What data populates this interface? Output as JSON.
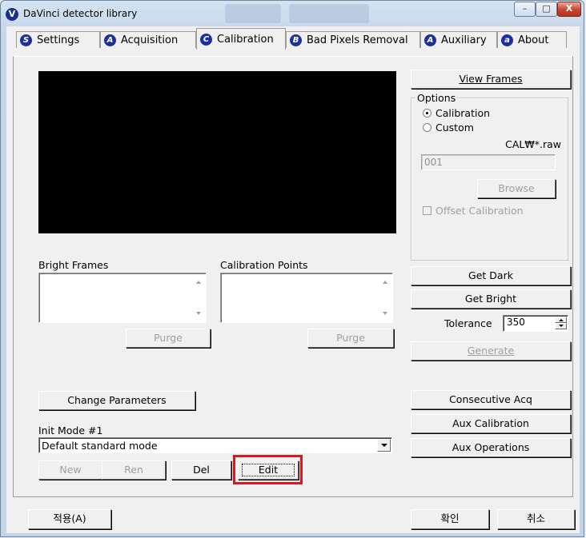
{
  "window": {
    "title": "DaVinci detector library",
    "minimize": "–",
    "maximize": "□",
    "close": "X"
  },
  "tabs": [
    {
      "label": "Settings",
      "icon": "S"
    },
    {
      "label": "Acquisition",
      "icon": "A"
    },
    {
      "label": "Calibration",
      "icon": "C",
      "active": true
    },
    {
      "label": "Bad Pixels Removal",
      "icon": "B"
    },
    {
      "label": "Auxiliary",
      "icon": "A"
    },
    {
      "label": "About",
      "icon": "a"
    }
  ],
  "left": {
    "bright_frames_label": "Bright Frames",
    "calibration_points_label": "Calibration Points",
    "purge_label": "Purge",
    "change_parameters": "Change Parameters",
    "init_mode_label": "Init Mode #1",
    "init_mode_value": "Default standard mode",
    "new": "New",
    "ren": "Ren",
    "del": "Del",
    "edit": "Edit"
  },
  "right": {
    "view_frames": "View Frames",
    "options_title": "Options",
    "radio_calibration": "Calibration",
    "radio_custom": "Custom",
    "file_pattern": "CAL₩*.raw",
    "file_index": "001",
    "browse": "Browse",
    "offset_calibration": "Offset Calibration",
    "get_dark": "Get Dark",
    "get_bright": "Get Bright",
    "tolerance_label": "Tolerance",
    "tolerance_value": "350",
    "generate": "Generate",
    "consecutive_acq": "Consecutive Acq",
    "aux_calibration": "Aux Calibration",
    "aux_operations": "Aux Operations"
  },
  "footer": {
    "apply": "적용(A)",
    "ok": "확인",
    "cancel": "취소"
  },
  "colors": {
    "highlight_border": "#e0161d",
    "preview_background": "#000000"
  }
}
